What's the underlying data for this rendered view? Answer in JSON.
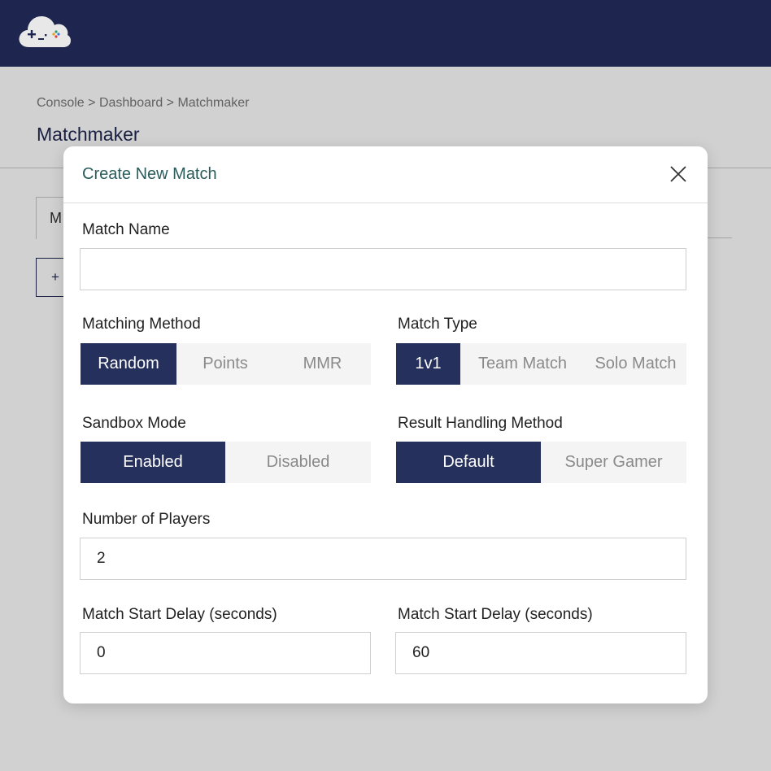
{
  "header": {
    "logo_icon": "cloud-gamepad-icon"
  },
  "page": {
    "breadcrumb": "Console > Dashboard > Matchmaker",
    "title": "Matchmaker",
    "tab_partial": "M",
    "add_partial": "+"
  },
  "modal": {
    "title": "Create New Match",
    "close_icon": "close-icon",
    "match_name": {
      "label": "Match Name",
      "value": "",
      "placeholder": ""
    },
    "matching_method": {
      "label": "Matching Method",
      "options": [
        "Random",
        "Points",
        "MMR"
      ],
      "selected": "Random"
    },
    "match_type": {
      "label": "Match Type",
      "options": [
        "1v1",
        "Team Match",
        "Solo Match"
      ],
      "selected": "1v1"
    },
    "sandbox_mode": {
      "label": "Sandbox Mode",
      "options": [
        "Enabled",
        "Disabled"
      ],
      "selected": "Enabled"
    },
    "result_handling": {
      "label": "Result Handling Method",
      "options": [
        "Default",
        "Super Gamer"
      ],
      "selected": "Default"
    },
    "num_players": {
      "label": "Number of Players",
      "value": "2"
    },
    "start_delay_1": {
      "label": "Match Start Delay (seconds)",
      "value": "0"
    },
    "start_delay_2": {
      "label": "Match Start Delay (seconds)",
      "value": "60"
    }
  },
  "colors": {
    "header_bg": "#1e2650",
    "accent": "#26305c",
    "modal_title": "#2a5c5c"
  }
}
